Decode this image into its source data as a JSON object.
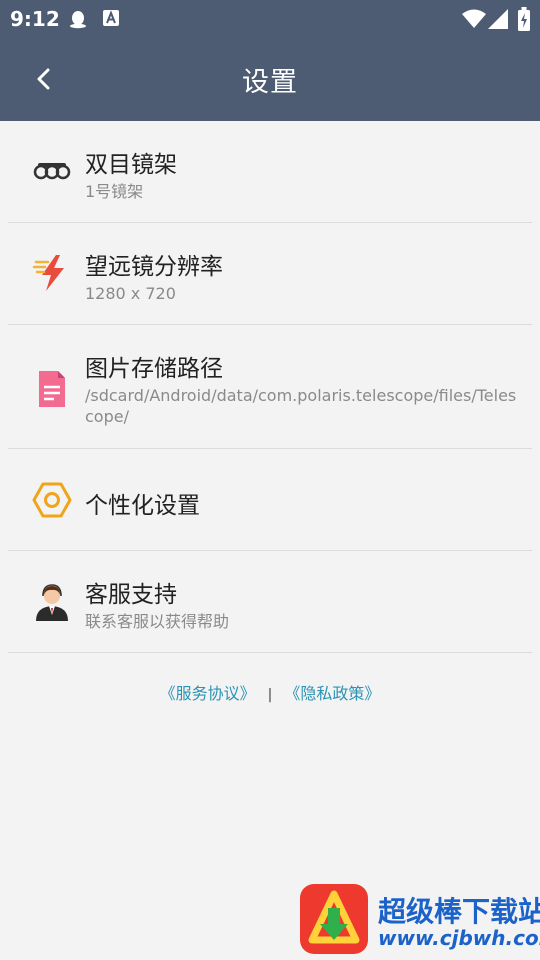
{
  "status_bar": {
    "time": "9:12"
  },
  "header": {
    "title": "设置"
  },
  "settings": [
    {
      "label": "双目镜架",
      "sub": "1号镜架",
      "icon": "binocular-icon"
    },
    {
      "label": "望远镜分辨率",
      "sub": "1280 x 720",
      "icon": "lightning-icon"
    },
    {
      "label": "图片存储路径",
      "sub": "/sdcard/Android/data/com.polaris.telescope/files/Telescope/",
      "icon": "document-icon"
    },
    {
      "label": "个性化设置",
      "icon": "hexagon-icon"
    },
    {
      "label": "客服支持",
      "sub": "联系客服以获得帮助",
      "icon": "customer-service-icon"
    }
  ],
  "footer": {
    "terms": "《服务协议》",
    "separator": "|",
    "privacy": "《隐私政策》"
  },
  "watermark": {
    "title": "超级棒下载站",
    "url": "www.cjbwh.com"
  },
  "colors": {
    "header_bg": "#4e5c73",
    "link": "#2a93b6",
    "background": "#f3f3f3"
  }
}
